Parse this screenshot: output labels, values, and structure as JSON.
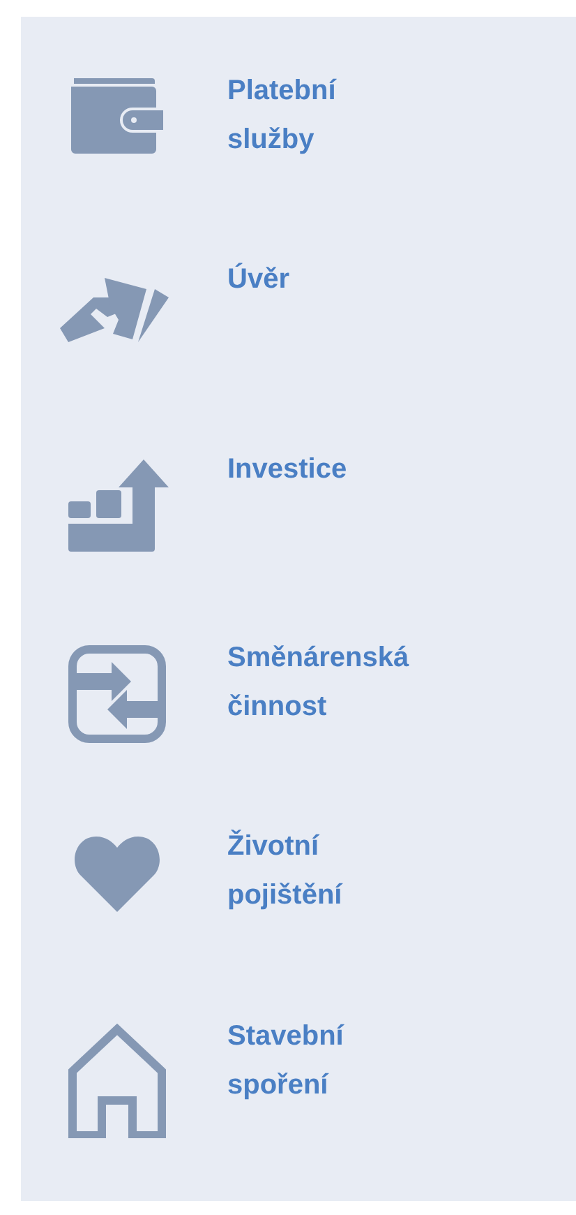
{
  "menu": {
    "items": [
      {
        "label": "Platební služby"
      },
      {
        "label": "Úvěr"
      },
      {
        "label": "Investice"
      },
      {
        "label": "Směnárenská činnost"
      },
      {
        "label": "Životní pojištění"
      },
      {
        "label": "Stavební spoření"
      }
    ]
  }
}
